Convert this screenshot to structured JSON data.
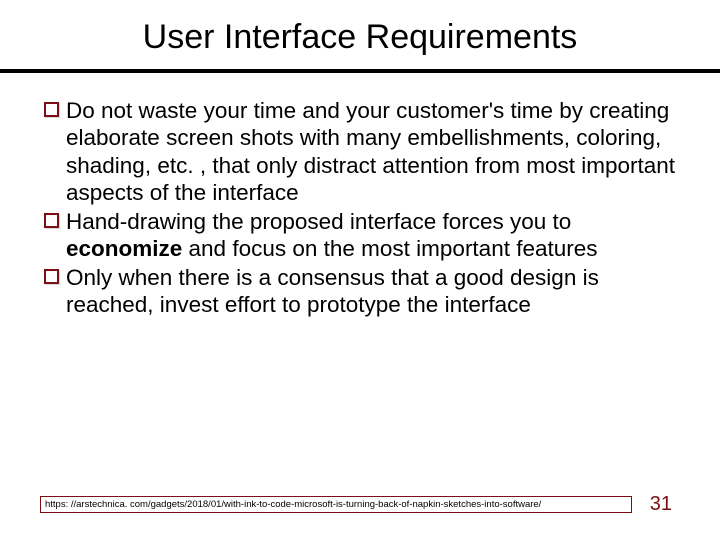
{
  "title": "User Interface Requirements",
  "bullets": [
    {
      "text": "Do not waste your time and your customer's time by creating elaborate screen shots with many embellishments, coloring, shading, etc. , that only distract attention from most important aspects of the interface"
    },
    {
      "html": "Hand-drawing the proposed interface forces you to <b>economize</b> and focus on the most important features"
    },
    {
      "text": "Only when there is a consensus that a good design is reached, invest effort to prototype the interface"
    }
  ],
  "footer_link": "https: //arstechnica. com/gadgets/2018/01/with-ink-to-code-microsoft-is-turning-back-of-napkin-sketches-into-software/",
  "page_number": "31",
  "colors": {
    "accent": "#7a1015"
  }
}
